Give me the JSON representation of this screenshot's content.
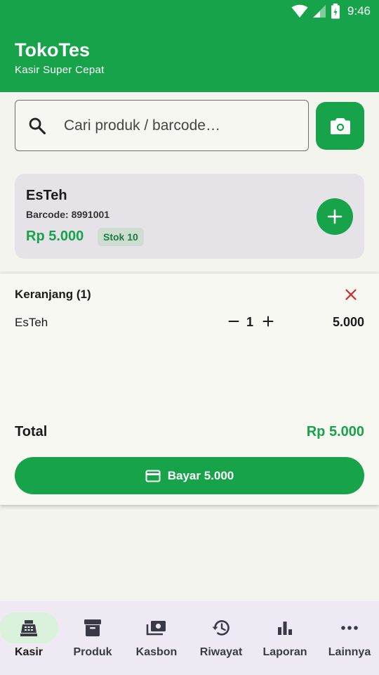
{
  "status_bar": {
    "time": "9:46"
  },
  "app": {
    "title": "TokoTes",
    "subtitle": "Kasir Super Cepat"
  },
  "search": {
    "placeholder": "Cari produk / barcode…"
  },
  "product": {
    "name": "EsTeh",
    "barcode": "Barcode: 8991001",
    "price": "Rp 5.000",
    "stock": "Stok 10"
  },
  "cart": {
    "title": "Keranjang (1)",
    "items": [
      {
        "name": "EsTeh",
        "qty": "1",
        "subtotal": "5.000"
      }
    ],
    "total_label": "Total",
    "total_value": "Rp 5.000",
    "pay_label": "Bayar 5.000"
  },
  "nav": {
    "items": [
      {
        "label": "Kasir",
        "icon": "cash-register-icon",
        "active": true
      },
      {
        "label": "Produk",
        "icon": "archive-box-icon",
        "active": false
      },
      {
        "label": "Kasbon",
        "icon": "payments-icon",
        "active": false
      },
      {
        "label": "Riwayat",
        "icon": "history-icon",
        "active": false
      },
      {
        "label": "Laporan",
        "icon": "bar-chart-icon",
        "active": false
      },
      {
        "label": "Lainnya",
        "icon": "more-horizontal-icon",
        "active": false
      }
    ]
  },
  "colors": {
    "primary": "#16a34a",
    "danger": "#dc2626",
    "card": "#e5e3e8",
    "nav_bg": "#efe9f3",
    "nav_active": "#daf1dc"
  }
}
